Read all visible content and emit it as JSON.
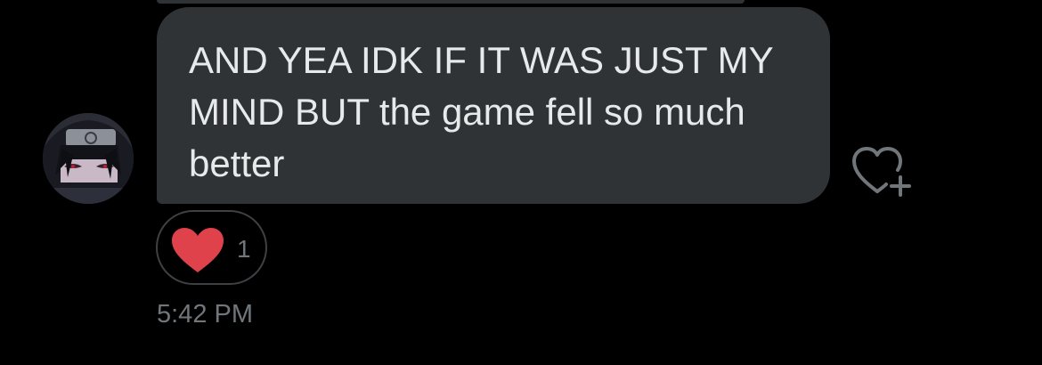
{
  "conversation": {
    "message": {
      "text": "AND YEA IDK IF IT WAS JUST MY MIND BUT the game fell so much better",
      "bubble_color": "#2f3336",
      "text_color": "#e7e9ea"
    },
    "reaction": {
      "emoji_icon": "red-heart-icon",
      "count": "1",
      "heart_color": "#e0424c"
    },
    "timestamp": "5:42 PM",
    "like_action_icon": "heart-plus-icon",
    "avatar_icon": "anime-character-avatar"
  }
}
